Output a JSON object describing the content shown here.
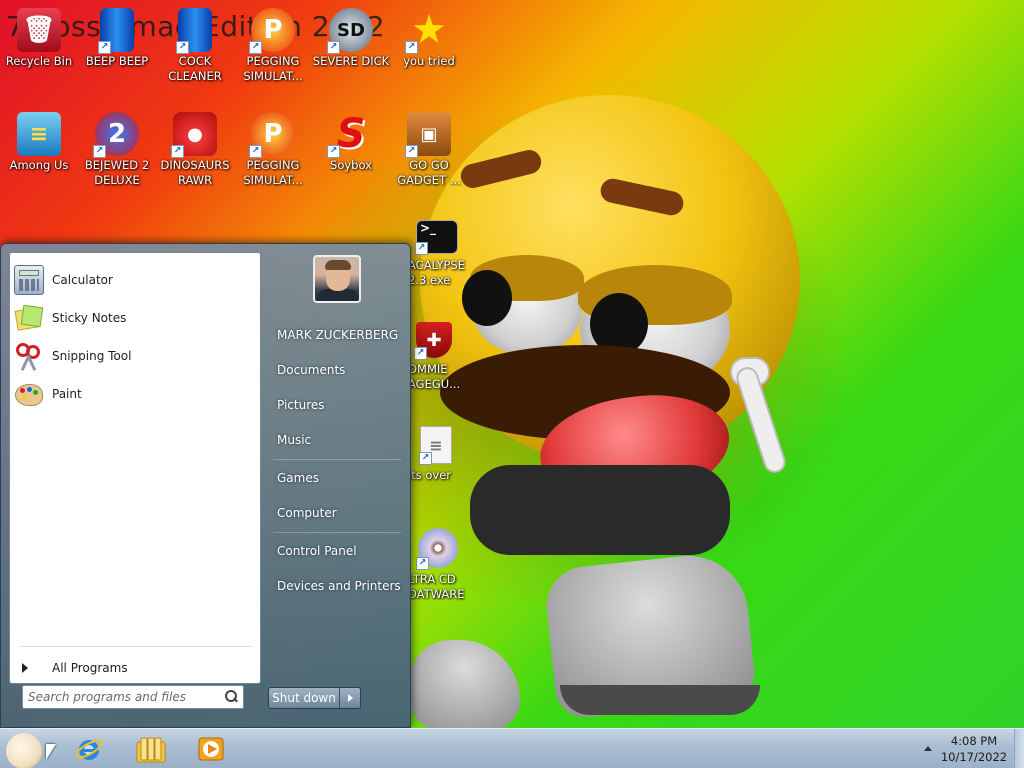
{
  "wallpaper": {
    "title_overlay": "7 BossK  mae Edition 2012"
  },
  "desktop_icons": [
    {
      "label": "Recycle Bin",
      "icon": "recycle-bin-icon",
      "color": "#c81a2a",
      "glyph": "🗑"
    },
    {
      "label": "BEEP BEEP",
      "icon": "blue-folder-icon",
      "color": "#1a6ad0",
      "glyph": ""
    },
    {
      "label": "COCK CLEANER",
      "icon": "blue-folder-icon",
      "color": "#1a6ad0",
      "glyph": ""
    },
    {
      "label": "PEGGING SIMULAT...",
      "icon": "pegging-p-icon",
      "color": "#e83010",
      "glyph": "P"
    },
    {
      "label": "SEVERE DICK",
      "icon": "gear-sd-icon",
      "color": "#5a6a7a",
      "glyph": "SD"
    },
    {
      "label": "you tried",
      "icon": "star-icon",
      "color": "#f4d400",
      "glyph": "★"
    },
    {
      "label": "Among Us",
      "icon": "among-us-icon",
      "color": "#2a8ad0",
      "glyph": "≡"
    },
    {
      "label": "BEJEWED 2 DELUXE",
      "icon": "bejeweled-icon",
      "color": "#c81a2a",
      "glyph": "2"
    },
    {
      "label": "DINOSAURS RAWR",
      "icon": "angry-bird-icon",
      "color": "#d82020",
      "glyph": "●"
    },
    {
      "label": "PEGGING SIMULAT...",
      "icon": "pegging-p-icon",
      "color": "#e83010",
      "glyph": "P"
    },
    {
      "label": "Soybox",
      "icon": "soybox-s-icon",
      "color": "#e01010",
      "glyph": "S"
    },
    {
      "label": "GO GO GADGET ...",
      "icon": "briefcase-icon",
      "color": "#b86a20",
      "glyph": "▣"
    },
    {
      "label": "ACALYPSE 2.3.exe",
      "icon": "cmd-icon",
      "color": "#111111",
      "glyph": ">_"
    },
    {
      "label": "OMMIE AGEGU...",
      "icon": "shield-icon",
      "color": "#c01818",
      "glyph": "✚"
    },
    {
      "label": "its over",
      "icon": "document-icon",
      "color": "#f0f0f0",
      "glyph": "≡"
    },
    {
      "label": "LTRA CD DATWARE",
      "icon": "cd-icon",
      "color": "#c8c8d8",
      "glyph": "◉"
    }
  ],
  "start_menu": {
    "programs": [
      {
        "label": "Calculator",
        "icon": "calculator-icon"
      },
      {
        "label": "Sticky Notes",
        "icon": "sticky-notes-icon"
      },
      {
        "label": "Snipping Tool",
        "icon": "scissors-icon"
      },
      {
        "label": "Paint",
        "icon": "paint-palette-icon"
      }
    ],
    "all_programs": "All Programs",
    "search_placeholder": "Search programs and files",
    "user_name": "MARK ZUCKERBERG",
    "right_items": [
      "Documents",
      "Pictures",
      "Music",
      "Games",
      "Computer",
      "Control Panel",
      "Devices and Printers"
    ],
    "shutdown_label": "Shut down"
  },
  "taskbar": {
    "pinned": [
      "internet-explorer-icon",
      "libraries-folder-icon",
      "media-player-icon"
    ],
    "time": "4:08 PM",
    "date": "10/17/2022"
  }
}
